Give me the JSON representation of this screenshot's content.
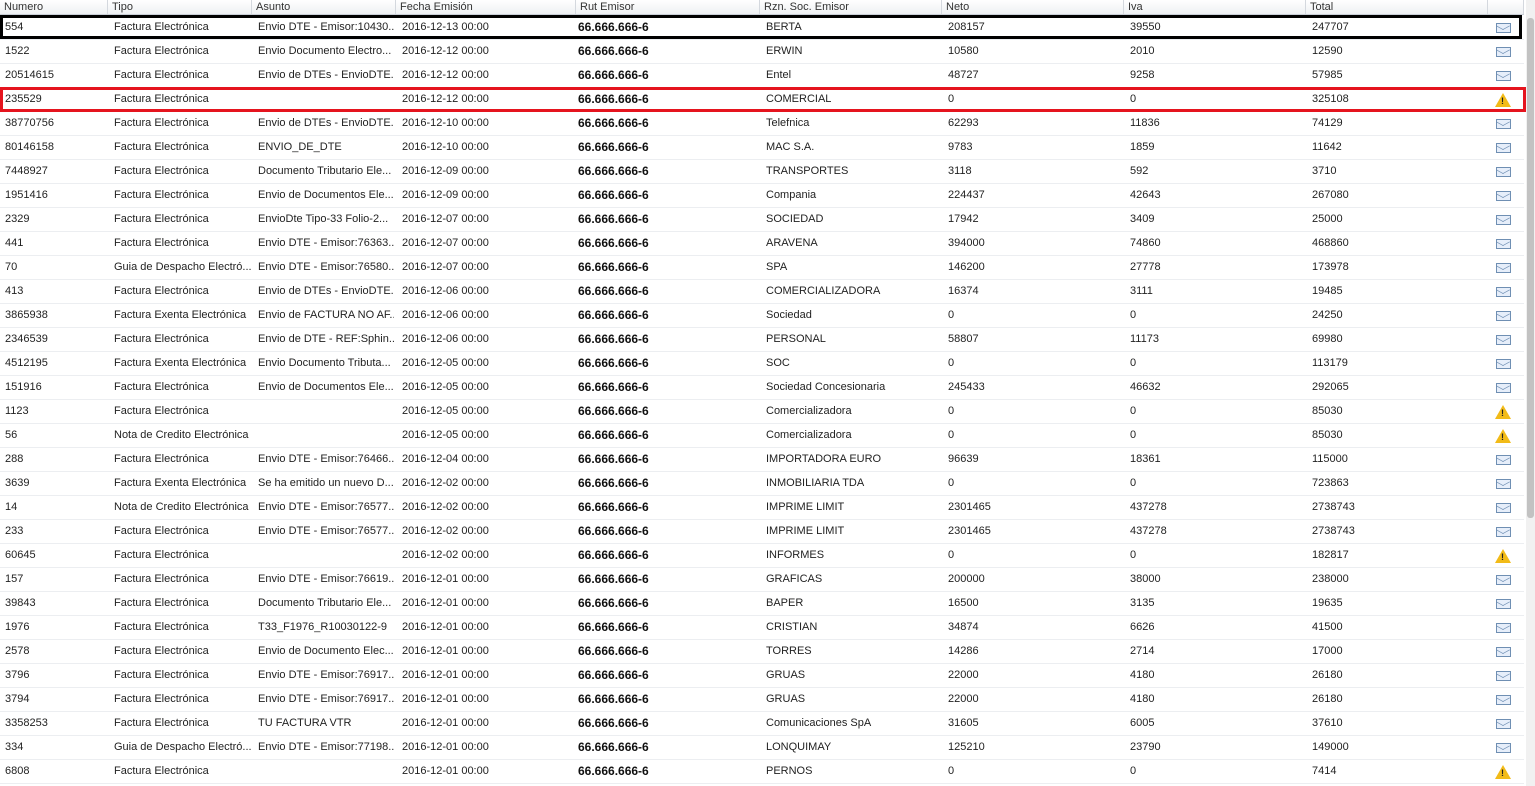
{
  "columns": [
    "Numero",
    "Tipo",
    "Asunto",
    "Fecha Emisión",
    "Rut Emisor",
    "Rzn. Soc. Emisor",
    "Neto",
    "Iva",
    "Total"
  ],
  "rows": [
    {
      "numero": "554",
      "tipo": "Factura Electrónica",
      "asunto": "Envio DTE - Emisor:10430...",
      "fecha": "2016-12-13 00:00",
      "rut": "66.666.666-6",
      "razon": "BERTA",
      "neto": "208157",
      "iva": "39550",
      "total": "247707",
      "icon": "mail-icon"
    },
    {
      "numero": "1522",
      "tipo": "Factura Electrónica",
      "asunto": "Envio Documento Electro...",
      "fecha": "2016-12-12 00:00",
      "rut": "66.666.666-6",
      "razon": "ERWIN",
      "neto": "10580",
      "iva": "2010",
      "total": "12590",
      "icon": "mail-icon"
    },
    {
      "numero": "20514615",
      "tipo": "Factura Electrónica",
      "asunto": "Envio de DTEs - EnvioDTE...",
      "fecha": "2016-12-12 00:00",
      "rut": "66.666.666-6",
      "razon": "Entel",
      "neto": "48727",
      "iva": "9258",
      "total": "57985",
      "icon": "mail-icon"
    },
    {
      "numero": "235529",
      "tipo": "Factura Electrónica",
      "asunto": "",
      "fecha": "2016-12-12 00:00",
      "rut": "66.666.666-6",
      "razon": "COMERCIAL",
      "neto": "0",
      "iva": "0",
      "total": "325108",
      "icon": "warning-icon"
    },
    {
      "numero": "38770756",
      "tipo": "Factura Electrónica",
      "asunto": "Envio de DTEs - EnvioDTE...",
      "fecha": "2016-12-10 00:00",
      "rut": "66.666.666-6",
      "razon": "Telefnica",
      "neto": "62293",
      "iva": "11836",
      "total": "74129",
      "icon": "mail-icon"
    },
    {
      "numero": "80146158",
      "tipo": "Factura Electrónica",
      "asunto": "ENVIO_DE_DTE",
      "fecha": "2016-12-10 00:00",
      "rut": "66.666.666-6",
      "razon": "MAC S.A.",
      "neto": "9783",
      "iva": "1859",
      "total": "11642",
      "icon": "mail-icon"
    },
    {
      "numero": "7448927",
      "tipo": "Factura Electrónica",
      "asunto": "Documento Tributario Ele...",
      "fecha": "2016-12-09 00:00",
      "rut": "66.666.666-6",
      "razon": "TRANSPORTES",
      "neto": "3118",
      "iva": "592",
      "total": "3710",
      "icon": "mail-icon"
    },
    {
      "numero": "1951416",
      "tipo": "Factura Electrónica",
      "asunto": "Envio de Documentos Ele...",
      "fecha": "2016-12-09 00:00",
      "rut": "66.666.666-6",
      "razon": "Compania",
      "neto": "224437",
      "iva": "42643",
      "total": "267080",
      "icon": "mail-icon"
    },
    {
      "numero": "2329",
      "tipo": "Factura Electrónica",
      "asunto": "EnvioDte Tipo-33 Folio-2...",
      "fecha": "2016-12-07 00:00",
      "rut": "66.666.666-6",
      "razon": "SOCIEDAD",
      "neto": "17942",
      "iva": "3409",
      "total": "25000",
      "icon": "mail-icon"
    },
    {
      "numero": "441",
      "tipo": "Factura Electrónica",
      "asunto": "Envio DTE - Emisor:76363...",
      "fecha": "2016-12-07 00:00",
      "rut": "66.666.666-6",
      "razon": "ARAVENA",
      "neto": "394000",
      "iva": "74860",
      "total": "468860",
      "icon": "mail-icon"
    },
    {
      "numero": "70",
      "tipo": "Guia de Despacho Electró...",
      "asunto": "Envio DTE - Emisor:76580...",
      "fecha": "2016-12-07 00:00",
      "rut": "66.666.666-6",
      "razon": "SPA",
      "neto": "146200",
      "iva": "27778",
      "total": "173978",
      "icon": "mail-icon"
    },
    {
      "numero": "413",
      "tipo": "Factura Electrónica",
      "asunto": "Envio de DTEs - EnvioDTE...",
      "fecha": "2016-12-06 00:00",
      "rut": "66.666.666-6",
      "razon": "COMERCIALIZADORA",
      "neto": "16374",
      "iva": "3111",
      "total": "19485",
      "icon": "mail-icon"
    },
    {
      "numero": "3865938",
      "tipo": "Factura Exenta Electrónica",
      "asunto": "Envio de FACTURA NO AF...",
      "fecha": "2016-12-06 00:00",
      "rut": "66.666.666-6",
      "razon": "Sociedad",
      "neto": "0",
      "iva": "0",
      "total": "24250",
      "icon": "mail-icon"
    },
    {
      "numero": "2346539",
      "tipo": "Factura Electrónica",
      "asunto": "Envio de DTE - REF:Sphin...",
      "fecha": "2016-12-06 00:00",
      "rut": "66.666.666-6",
      "razon": "PERSONAL",
      "neto": "58807",
      "iva": "11173",
      "total": "69980",
      "icon": "mail-icon"
    },
    {
      "numero": "4512195",
      "tipo": "Factura Exenta Electrónica",
      "asunto": "Envio Documento Tributa...",
      "fecha": "2016-12-05 00:00",
      "rut": "66.666.666-6",
      "razon": "SOC",
      "neto": "0",
      "iva": "0",
      "total": "113179",
      "icon": "mail-icon"
    },
    {
      "numero": "151916",
      "tipo": "Factura Electrónica",
      "asunto": "Envio de Documentos Ele...",
      "fecha": "2016-12-05 00:00",
      "rut": "66.666.666-6",
      "razon": "Sociedad Concesionaria",
      "neto": "245433",
      "iva": "46632",
      "total": "292065",
      "icon": "mail-icon"
    },
    {
      "numero": "1123",
      "tipo": "Factura Electrónica",
      "asunto": "",
      "fecha": "2016-12-05 00:00",
      "rut": "66.666.666-6",
      "razon": "Comercializadora",
      "neto": "0",
      "iva": "0",
      "total": "85030",
      "icon": "warning-icon"
    },
    {
      "numero": "56",
      "tipo": "Nota de Credito Electrónica",
      "asunto": "",
      "fecha": "2016-12-05 00:00",
      "rut": "66.666.666-6",
      "razon": "Comercializadora",
      "neto": "0",
      "iva": "0",
      "total": "85030",
      "icon": "warning-icon"
    },
    {
      "numero": "288",
      "tipo": "Factura Electrónica",
      "asunto": "Envio DTE - Emisor:76466...",
      "fecha": "2016-12-04 00:00",
      "rut": "66.666.666-6",
      "razon": "IMPORTADORA EURO",
      "neto": "96639",
      "iva": "18361",
      "total": "115000",
      "icon": "mail-icon"
    },
    {
      "numero": "3639",
      "tipo": "Factura Exenta Electrónica",
      "asunto": "Se ha emitido un nuevo D...",
      "fecha": "2016-12-02 00:00",
      "rut": "66.666.666-6",
      "razon": "INMOBILIARIA TDA",
      "neto": "0",
      "iva": "0",
      "total": "723863",
      "icon": "mail-icon"
    },
    {
      "numero": "14",
      "tipo": "Nota de Credito Electrónica",
      "asunto": "Envio DTE - Emisor:76577...",
      "fecha": "2016-12-02 00:00",
      "rut": "66.666.666-6",
      "razon": "IMPRIME LIMIT",
      "neto": "2301465",
      "iva": "437278",
      "total": "2738743",
      "icon": "mail-icon"
    },
    {
      "numero": "233",
      "tipo": "Factura Electrónica",
      "asunto": "Envio DTE - Emisor:76577...",
      "fecha": "2016-12-02 00:00",
      "rut": "66.666.666-6",
      "razon": "IMPRIME LIMIT",
      "neto": "2301465",
      "iva": "437278",
      "total": "2738743",
      "icon": "mail-icon"
    },
    {
      "numero": "60645",
      "tipo": "Factura Electrónica",
      "asunto": "",
      "fecha": "2016-12-02 00:00",
      "rut": "66.666.666-6",
      "razon": "INFORMES",
      "neto": "0",
      "iva": "0",
      "total": "182817",
      "icon": "warning-icon"
    },
    {
      "numero": "157",
      "tipo": "Factura Electrónica",
      "asunto": "Envio DTE - Emisor:76619...",
      "fecha": "2016-12-01 00:00",
      "rut": "66.666.666-6",
      "razon": "GRAFICAS",
      "neto": "200000",
      "iva": "38000",
      "total": "238000",
      "icon": "mail-icon"
    },
    {
      "numero": "39843",
      "tipo": "Factura Electrónica",
      "asunto": "Documento Tributario Ele...",
      "fecha": "2016-12-01 00:00",
      "rut": "66.666.666-6",
      "razon": "BAPER",
      "neto": "16500",
      "iva": "3135",
      "total": "19635",
      "icon": "mail-icon"
    },
    {
      "numero": "1976",
      "tipo": "Factura Electrónica",
      "asunto": "T33_F1976_R10030122-9",
      "fecha": "2016-12-01 00:00",
      "rut": "66.666.666-6",
      "razon": "CRISTIAN",
      "neto": "34874",
      "iva": "6626",
      "total": "41500",
      "icon": "mail-icon"
    },
    {
      "numero": "2578",
      "tipo": "Factura Electrónica",
      "asunto": "Envio de Documento Elec...",
      "fecha": "2016-12-01 00:00",
      "rut": "66.666.666-6",
      "razon": "TORRES",
      "neto": "14286",
      "iva": "2714",
      "total": "17000",
      "icon": "mail-icon"
    },
    {
      "numero": "3796",
      "tipo": "Factura Electrónica",
      "asunto": "Envio DTE - Emisor:76917...",
      "fecha": "2016-12-01 00:00",
      "rut": "66.666.666-6",
      "razon": "GRUAS",
      "neto": "22000",
      "iva": "4180",
      "total": "26180",
      "icon": "mail-icon"
    },
    {
      "numero": "3794",
      "tipo": "Factura Electrónica",
      "asunto": "Envio DTE - Emisor:76917...",
      "fecha": "2016-12-01 00:00",
      "rut": "66.666.666-6",
      "razon": "GRUAS",
      "neto": "22000",
      "iva": "4180",
      "total": "26180",
      "icon": "mail-icon"
    },
    {
      "numero": "3358253",
      "tipo": "Factura Electrónica",
      "asunto": "TU FACTURA VTR",
      "fecha": "2016-12-01 00:00",
      "rut": "66.666.666-6",
      "razon": "Comunicaciones SpA",
      "neto": "31605",
      "iva": "6005",
      "total": "37610",
      "icon": "mail-icon"
    },
    {
      "numero": "334",
      "tipo": "Guia de Despacho Electró...",
      "asunto": "Envio DTE - Emisor:77198...",
      "fecha": "2016-12-01 00:00",
      "rut": "66.666.666-6",
      "razon": "LONQUIMAY",
      "neto": "125210",
      "iva": "23790",
      "total": "149000",
      "icon": "mail-icon"
    },
    {
      "numero": "6808",
      "tipo": "Factura Electrónica",
      "asunto": "",
      "fecha": "2016-12-01 00:00",
      "rut": "66.666.666-6",
      "razon": "PERNOS",
      "neto": "0",
      "iva": "0",
      "total": "7414",
      "icon": "warning-icon"
    }
  ],
  "highlights": {
    "black_row_index": 0,
    "red_row_index": 3,
    "black_color": "#000000",
    "red_color": "#e5141e"
  },
  "colors": {
    "warning": "#f2bb18",
    "mail": "#6f8fb3",
    "header_border": "#c9ced6"
  }
}
